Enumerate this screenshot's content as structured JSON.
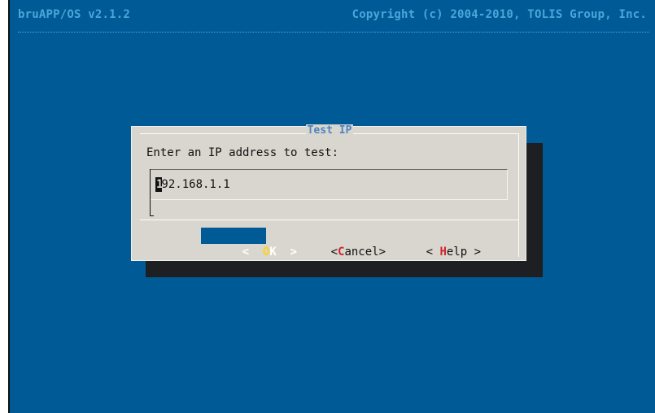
{
  "topbar": {
    "brand": "bruAPP/OS v2.1.2",
    "copyright": "Copyright (c) 2004-2010, TOLIS Group, Inc."
  },
  "dialog": {
    "title": "Test IP",
    "prompt": "Enter an IP address to test:",
    "input": {
      "value": "192.168.1.1",
      "cursor_char": "1"
    },
    "buttons": {
      "ok": {
        "prefix": "<  ",
        "hotkey": "O",
        "rest": "K  >"
      },
      "cancel": {
        "prefix": "<",
        "hotkey": "C",
        "rest": "ancel>"
      },
      "help": {
        "prefix": "< ",
        "hotkey": "H",
        "rest": "elp >"
      }
    }
  },
  "colors": {
    "background": "#005a96",
    "dialog": "#d9d6cf",
    "title": "#4b86c1",
    "hotkey_focus": "#ffd21a",
    "hotkey": "#d0262d"
  }
}
